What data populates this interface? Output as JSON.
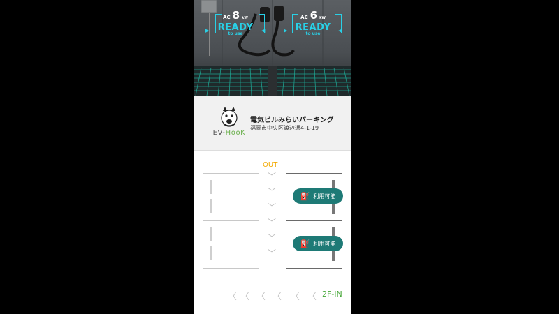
{
  "charger_left": {
    "ac": "AC",
    "power": "8",
    "unit": "kW",
    "status": "READY",
    "substatus": "to use"
  },
  "charger_right": {
    "ac": "AC",
    "power": "6",
    "unit": "kW",
    "status": "READY",
    "substatus": "to use"
  },
  "logo": {
    "text_a": "EV-",
    "text_b": "HooK"
  },
  "facility": {
    "name": "電気ビルみらいパーキング",
    "address": "福岡市中央区渡辺通4-1-19"
  },
  "parking": {
    "exit_label": "OUT",
    "entrance_label": "2F-IN",
    "spots": [
      {
        "status": "利用可能",
        "icon": "ev-charger-icon"
      },
      {
        "status": "利用可能",
        "icon": "ev-charger-icon"
      }
    ]
  },
  "colors": {
    "accent_teal": "#1e7a76",
    "out": "#f2a900",
    "in": "#44a636",
    "ready": "#29d0e6"
  }
}
